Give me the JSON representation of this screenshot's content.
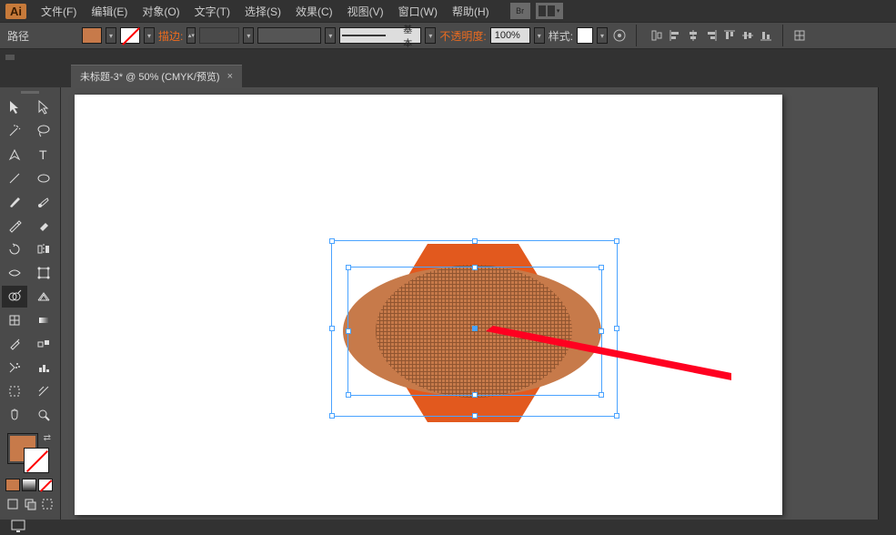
{
  "app": {
    "logo": "Ai"
  },
  "menu": {
    "file": "文件(F)",
    "edit": "编辑(E)",
    "object": "对象(O)",
    "type": "文字(T)",
    "select": "选择(S)",
    "effect": "效果(C)",
    "view": "视图(V)",
    "window": "窗口(W)",
    "help": "帮助(H)",
    "br": "Br"
  },
  "ctrl": {
    "path": "路径",
    "fill_color": "#c77a4a",
    "stroke_label": "描边:",
    "stroke_width": "",
    "brush_label": "基本",
    "opacity_label": "不透明度:",
    "opacity_value": "100%",
    "style_label": "样式:",
    "style_color": "#ffffff"
  },
  "tab": {
    "title": "未标题-3* @ 50% (CMYK/预览)",
    "close": "×"
  },
  "canvas": {
    "artboard_bg": "#ffffff",
    "back_shape_color": "#e2591e",
    "front_shape_color": "#c77a4a",
    "bbox_color": "#4aa3ff",
    "annotation_color": "#ff0033"
  },
  "tools": {
    "selection": "selection-tool",
    "direct": "direct-selection-tool",
    "magicwand": "magic-wand-tool",
    "lasso": "lasso-tool",
    "pen": "pen-tool",
    "type": "type-tool",
    "line": "line-tool",
    "ellipse": "ellipse-tool",
    "brush": "paintbrush-tool",
    "blob": "blob-brush-tool",
    "pencil": "pencil-tool",
    "eraser": "eraser-tool",
    "rotate": "rotate-tool",
    "reflect": "reflect-tool",
    "scale": "width-tool",
    "shear": "free-transform-tool",
    "shapebuilder": "shape-builder-tool",
    "perspective": "perspective-grid-tool",
    "mesh": "mesh-tool",
    "gradient": "gradient-tool",
    "eyedrop": "eyedropper-tool",
    "measure": "blend-tool",
    "symbol": "symbol-sprayer-tool",
    "column": "column-graph-tool",
    "artboard": "artboard-tool",
    "slice": "slice-tool",
    "hand": "hand-tool",
    "zoom": "zoom-tool"
  },
  "colors": {
    "fill": "#c77a4a",
    "stroke_none": true
  }
}
